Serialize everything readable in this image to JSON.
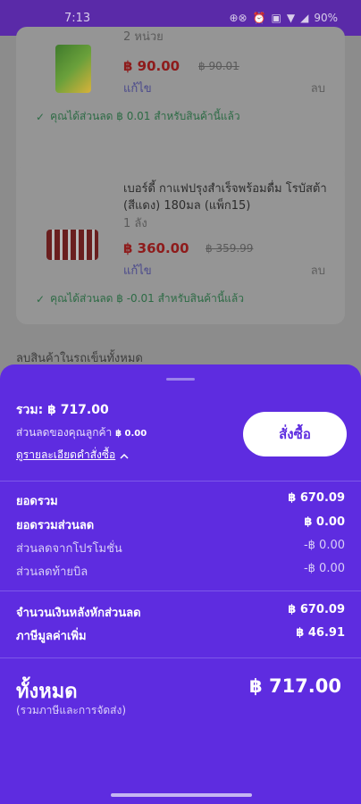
{
  "status_bar": {
    "time": "7:13",
    "battery": "90%"
  },
  "cart": {
    "items": [
      {
        "unit_top": "2 หน่วย",
        "price": "฿ 90.00",
        "old_price": "฿ 90.01",
        "edit_label": "แก้ไข",
        "delete_label": "ลบ",
        "discount_note": "คุณได้ส่วนลด ฿ 0.01 สำหรับสินค้านี้แล้ว"
      },
      {
        "name": "เบอร์ดี้ กาแฟปรุงสำเร็จพร้อมดื่ม โรบัสต้า (สีแดง) 180มล (แพ็ก15)",
        "unit": "1 ลัง",
        "price": "฿ 360.00",
        "old_price": "฿ 359.99",
        "edit_label": "แก้ไข",
        "delete_label": "ลบ",
        "discount_note": "คุณได้ส่วนลด ฿ -0.01 สำหรับสินค้านี้แล้ว"
      }
    ],
    "remove_all_label": "ลบสินค้าในรถเข็นทั้งหมด"
  },
  "summary": {
    "total_label": "รวม: ฿ 717.00",
    "customer_discount_label": "ส่วนลดของคุณลูกค้า",
    "customer_discount_value": "฿ 0.00",
    "order_details_label": "ดูรายละเอียดคำสั่งซื้อ",
    "order_button_label": "สั่งซื้อ",
    "rows": [
      {
        "label": "ยอดรวม",
        "value": "฿ 670.09"
      },
      {
        "label": "ยอดรวมส่วนลด",
        "value": "฿ 0.00"
      },
      {
        "label": "ส่วนลดจากโปรโมชั่น",
        "value": "-฿ 0.00"
      },
      {
        "label": "ส่วนลดท้ายบิล",
        "value": "-฿ 0.00"
      },
      {
        "label": "จำนวนเงินหลังหักส่วนลด",
        "value": "฿ 670.09"
      },
      {
        "label": "ภาษีมูลค่าเพิ่ม",
        "value": "฿ 46.91"
      }
    ],
    "grand_total_label": "ทั้งหมด",
    "grand_total_sublabel": "(รวมภาษีและการจัดส่ง)",
    "grand_total_value": "฿ 717.00"
  },
  "icons": {
    "check": "check-icon",
    "chevron_up": "chevron-up-icon"
  },
  "colors": {
    "brand_purple": "#5e2ce0",
    "status_bar": "#5a2aa8",
    "price_red": "#8e1b1b",
    "discount_green": "#2d6b45"
  }
}
